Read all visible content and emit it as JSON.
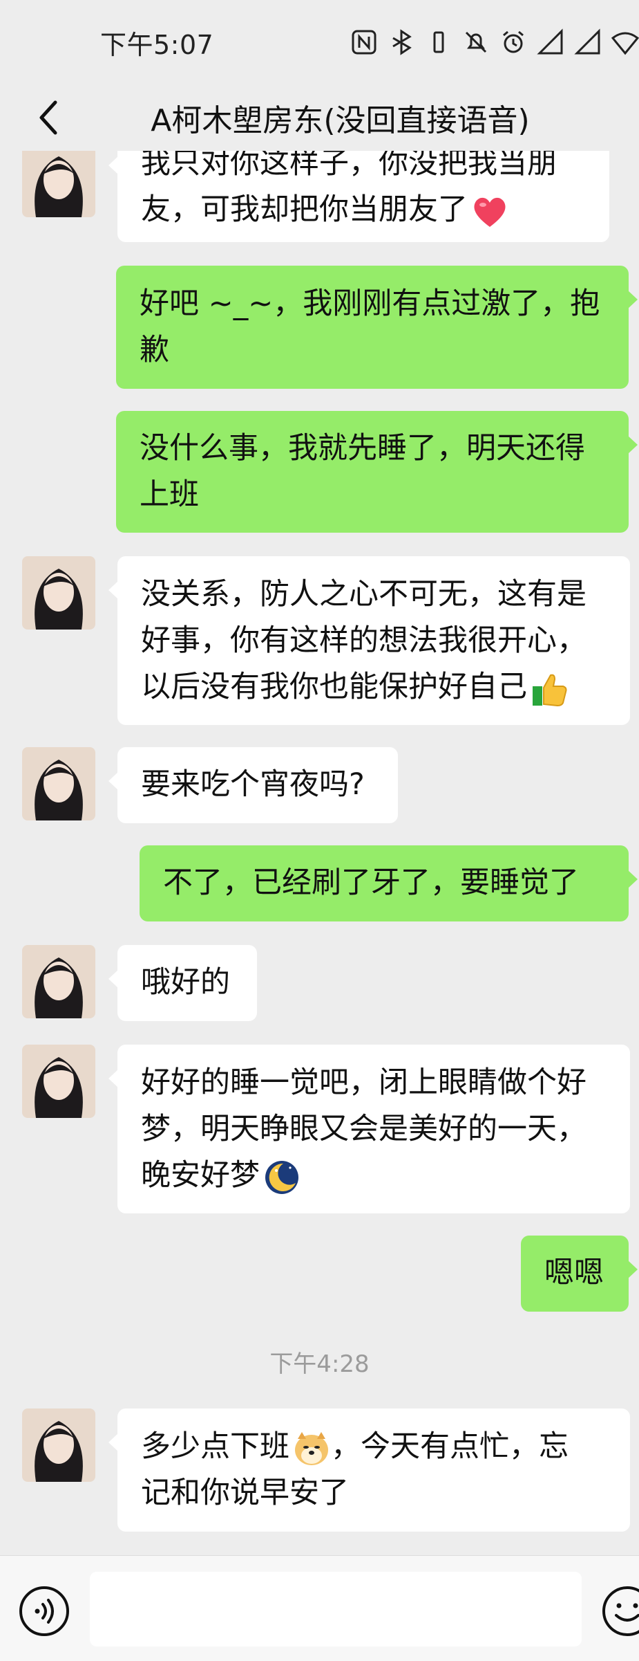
{
  "status_bar": {
    "time": "下午5:07",
    "icons": [
      "nfc-icon",
      "bluetooth-icon",
      "vibrate-icon",
      "mute-icon",
      "alarm-icon",
      "signal-icon",
      "signal-icon",
      "wifi-icon"
    ]
  },
  "header": {
    "title": "A柯木塱房东(没回直接语音)"
  },
  "messages": [
    {
      "side": "left",
      "lines": [
        "我只对你这样子，你没把我当朋",
        "友，可我却把你当朋友了"
      ],
      "emoji": "red-heart"
    },
    {
      "side": "right",
      "lines": [
        "好吧 ~_~，我刚刚有点过激了，抱",
        "歉"
      ]
    },
    {
      "side": "right",
      "lines": [
        "没什么事，我就先睡了，明天还得",
        "上班"
      ]
    },
    {
      "side": "left",
      "lines": [
        "没关系，防人之心不可无，这有是",
        "好事，你有这样的想法我很开心，",
        "以后没有我你也能保护好自己"
      ],
      "emoji": "thumbs-up"
    },
    {
      "side": "left",
      "lines": [
        "要来吃个宵夜吗?"
      ]
    },
    {
      "side": "right",
      "lines": [
        "不了，已经刷了牙了，要睡觉了"
      ]
    },
    {
      "side": "left",
      "lines": [
        "哦好的"
      ]
    },
    {
      "side": "left",
      "lines": [
        "好好的睡一觉吧，闭上眼睛做个好",
        "梦，明天睁眼又会是美好的一天，",
        "晚安好梦"
      ],
      "emoji": "moon"
    },
    {
      "side": "right",
      "lines": [
        "嗯嗯"
      ]
    },
    {
      "side": "left",
      "lines": [
        "多少点下班",
        "记和你说早安了"
      ],
      "emoji_inline_after_first_part": "doge",
      "first_line_suffix": "，今天有点忙，忘"
    }
  ],
  "timestamp": "下午4:28",
  "input_bar": {
    "placeholder": ""
  },
  "colors": {
    "background": "#ededed",
    "bubble_self": "#95ec69",
    "bubble_other": "#ffffff",
    "timestamp": "#9b9b9b"
  }
}
